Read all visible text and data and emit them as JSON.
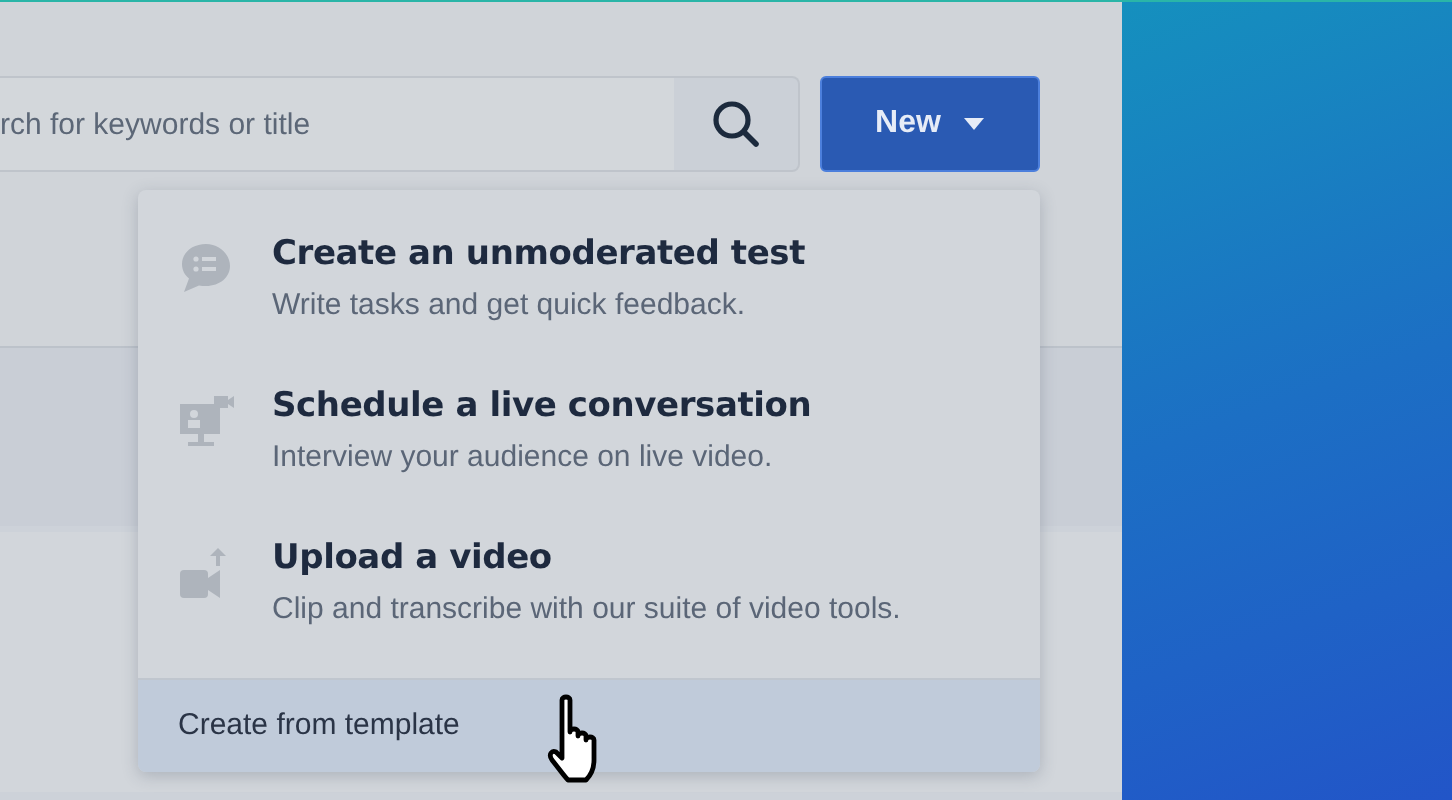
{
  "search": {
    "placeholder": "rch for keywords or title"
  },
  "new_button": {
    "label": "New",
    "expanded": true
  },
  "menu": {
    "items": [
      {
        "kind": "chat",
        "title": "Create an unmoderated test",
        "description": "Write tasks and get quick feedback."
      },
      {
        "kind": "screen",
        "title": "Schedule a live conversation",
        "description": "Interview your audience on live video."
      },
      {
        "kind": "upload",
        "title": "Upload a video",
        "description": "Clip and transcribe with our suite of video tools."
      }
    ],
    "footer": {
      "label": "Create from template",
      "hovered": true
    }
  }
}
